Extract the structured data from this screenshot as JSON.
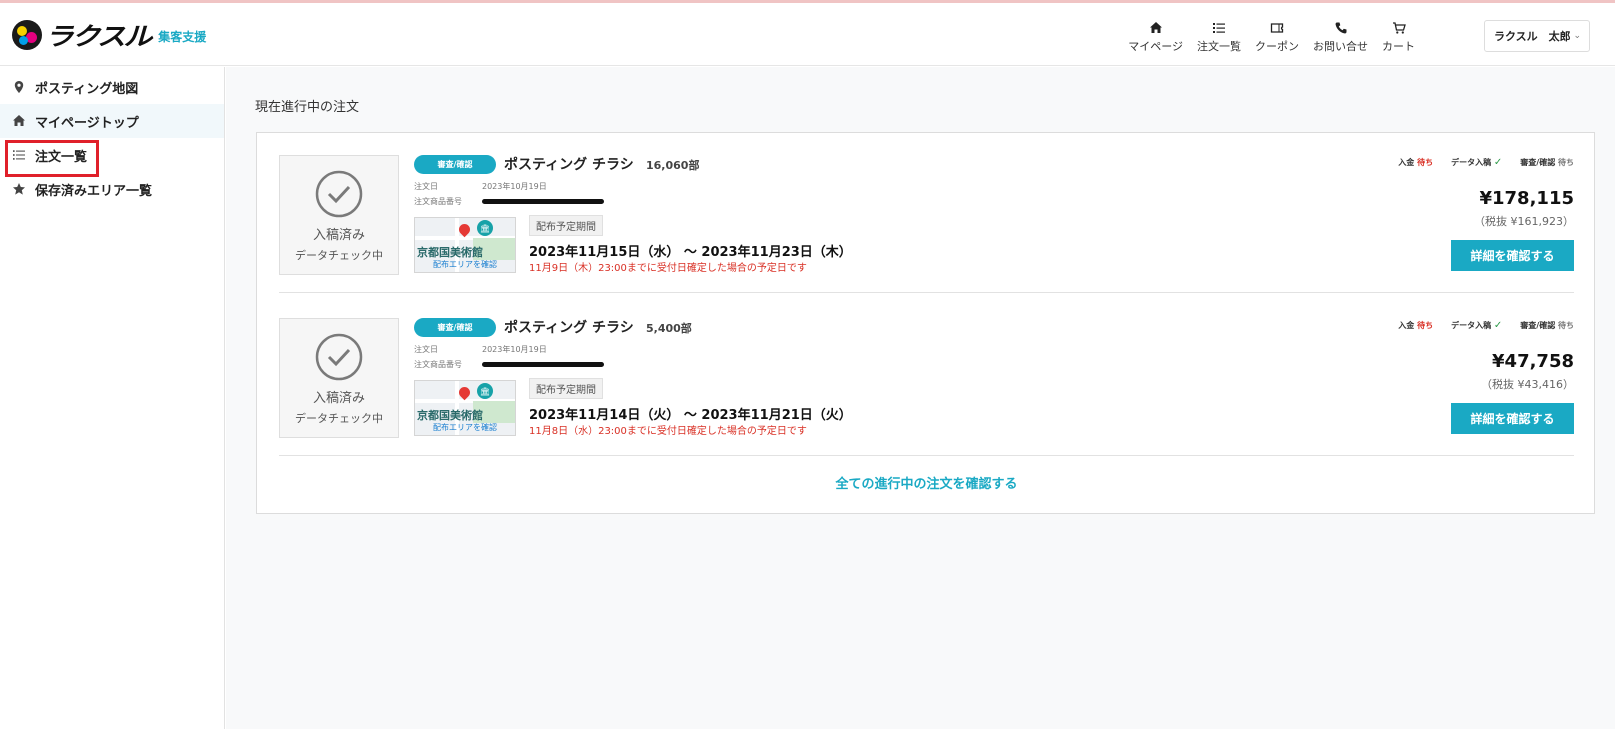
{
  "header": {
    "logo_text": "ラクスル",
    "logo_sub": "集客支援",
    "nav": [
      {
        "label": "マイページ",
        "icon": "home-icon"
      },
      {
        "label": "注文一覧",
        "icon": "list-icon"
      },
      {
        "label": "クーポン",
        "icon": "coupon-icon"
      },
      {
        "label": "お問い合せ",
        "icon": "phone-icon"
      },
      {
        "label": "カート",
        "icon": "cart-icon"
      }
    ],
    "user_name": "ラクスル　太郎"
  },
  "sidebar": {
    "items": [
      {
        "label": "ポスティング地図",
        "icon": "map-pin-icon"
      },
      {
        "label": "マイページトップ",
        "icon": "home-icon"
      },
      {
        "label": "注文一覧",
        "icon": "list-icon"
      },
      {
        "label": "保存済みエリア一覧",
        "icon": "star-icon"
      }
    ]
  },
  "main": {
    "section_title": "現在進行中の注文",
    "orders": [
      {
        "status_main": "入稿済み",
        "status_sub": "データチェック中",
        "badge": "審査/確認",
        "product": "ポスティング チラシ",
        "quantity": "16,060部",
        "order_date_label": "注文日",
        "order_date": "2023年10月19日",
        "order_no_label": "注文商品番号",
        "map_place": "京都国美術館",
        "map_caption": "配布エリアを確認",
        "period_label": "配布予定期間",
        "period": "2023年11月15日（水） ～ 2023年11月23日（木）",
        "period_note": "11月9日（木）23:00までに受付日確定した場合の予定日です",
        "steps": {
          "payment_label": "入金",
          "payment_status": "待ち",
          "data_label": "データ入稿",
          "data_check": "✓",
          "review_label": "審査/確認",
          "review_status": "待ち"
        },
        "price": "¥178,115",
        "price_sub": "（税抜 ¥161,923）",
        "detail_button": "詳細を確認する"
      },
      {
        "status_main": "入稿済み",
        "status_sub": "データチェック中",
        "badge": "審査/確認",
        "product": "ポスティング チラシ",
        "quantity": "5,400部",
        "order_date_label": "注文日",
        "order_date": "2023年10月19日",
        "order_no_label": "注文商品番号",
        "map_place": "京都国美術館",
        "map_caption": "配布エリアを確認",
        "period_label": "配布予定期間",
        "period": "2023年11月14日（火） ～ 2023年11月21日（火）",
        "period_note": "11月8日（水）23:00までに受付日確定した場合の予定日です",
        "steps": {
          "payment_label": "入金",
          "payment_status": "待ち",
          "data_label": "データ入稿",
          "data_check": "✓",
          "review_label": "審査/確認",
          "review_status": "待ち"
        },
        "price": "¥47,758",
        "price_sub": "（税抜 ¥43,416）",
        "detail_button": "詳細を確認する"
      }
    ],
    "all_link": "全ての進行中の注文を確認する"
  },
  "colors": {
    "accent": "#1aa9c4",
    "warning_text": "#d93025",
    "highlight_box": "#e0202a"
  }
}
